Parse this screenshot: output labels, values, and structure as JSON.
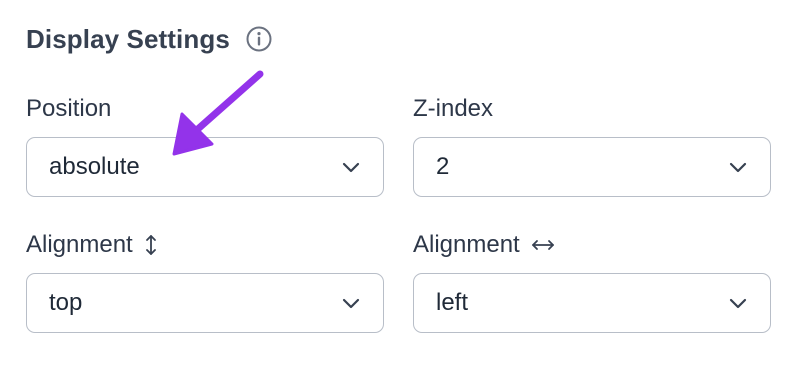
{
  "section": {
    "title": "Display Settings",
    "info_icon": "info-circle-icon"
  },
  "fields": {
    "position": {
      "label": "Position",
      "value": "absolute"
    },
    "z_index": {
      "label": "Z-index",
      "value": "2"
    },
    "alignment_vertical": {
      "label": "Alignment",
      "label_icon": "vertical-arrows-icon",
      "value": "top"
    },
    "alignment_horizontal": {
      "label": "Alignment",
      "label_icon": "horizontal-arrows-icon",
      "value": "left"
    }
  },
  "annotation": {
    "arrow_color": "#9333ea",
    "arrow_icon": "pointer-arrow-icon"
  },
  "colors": {
    "border": "#b8bec8",
    "text": "#1f2937",
    "muted_icon": "#6b7280"
  }
}
